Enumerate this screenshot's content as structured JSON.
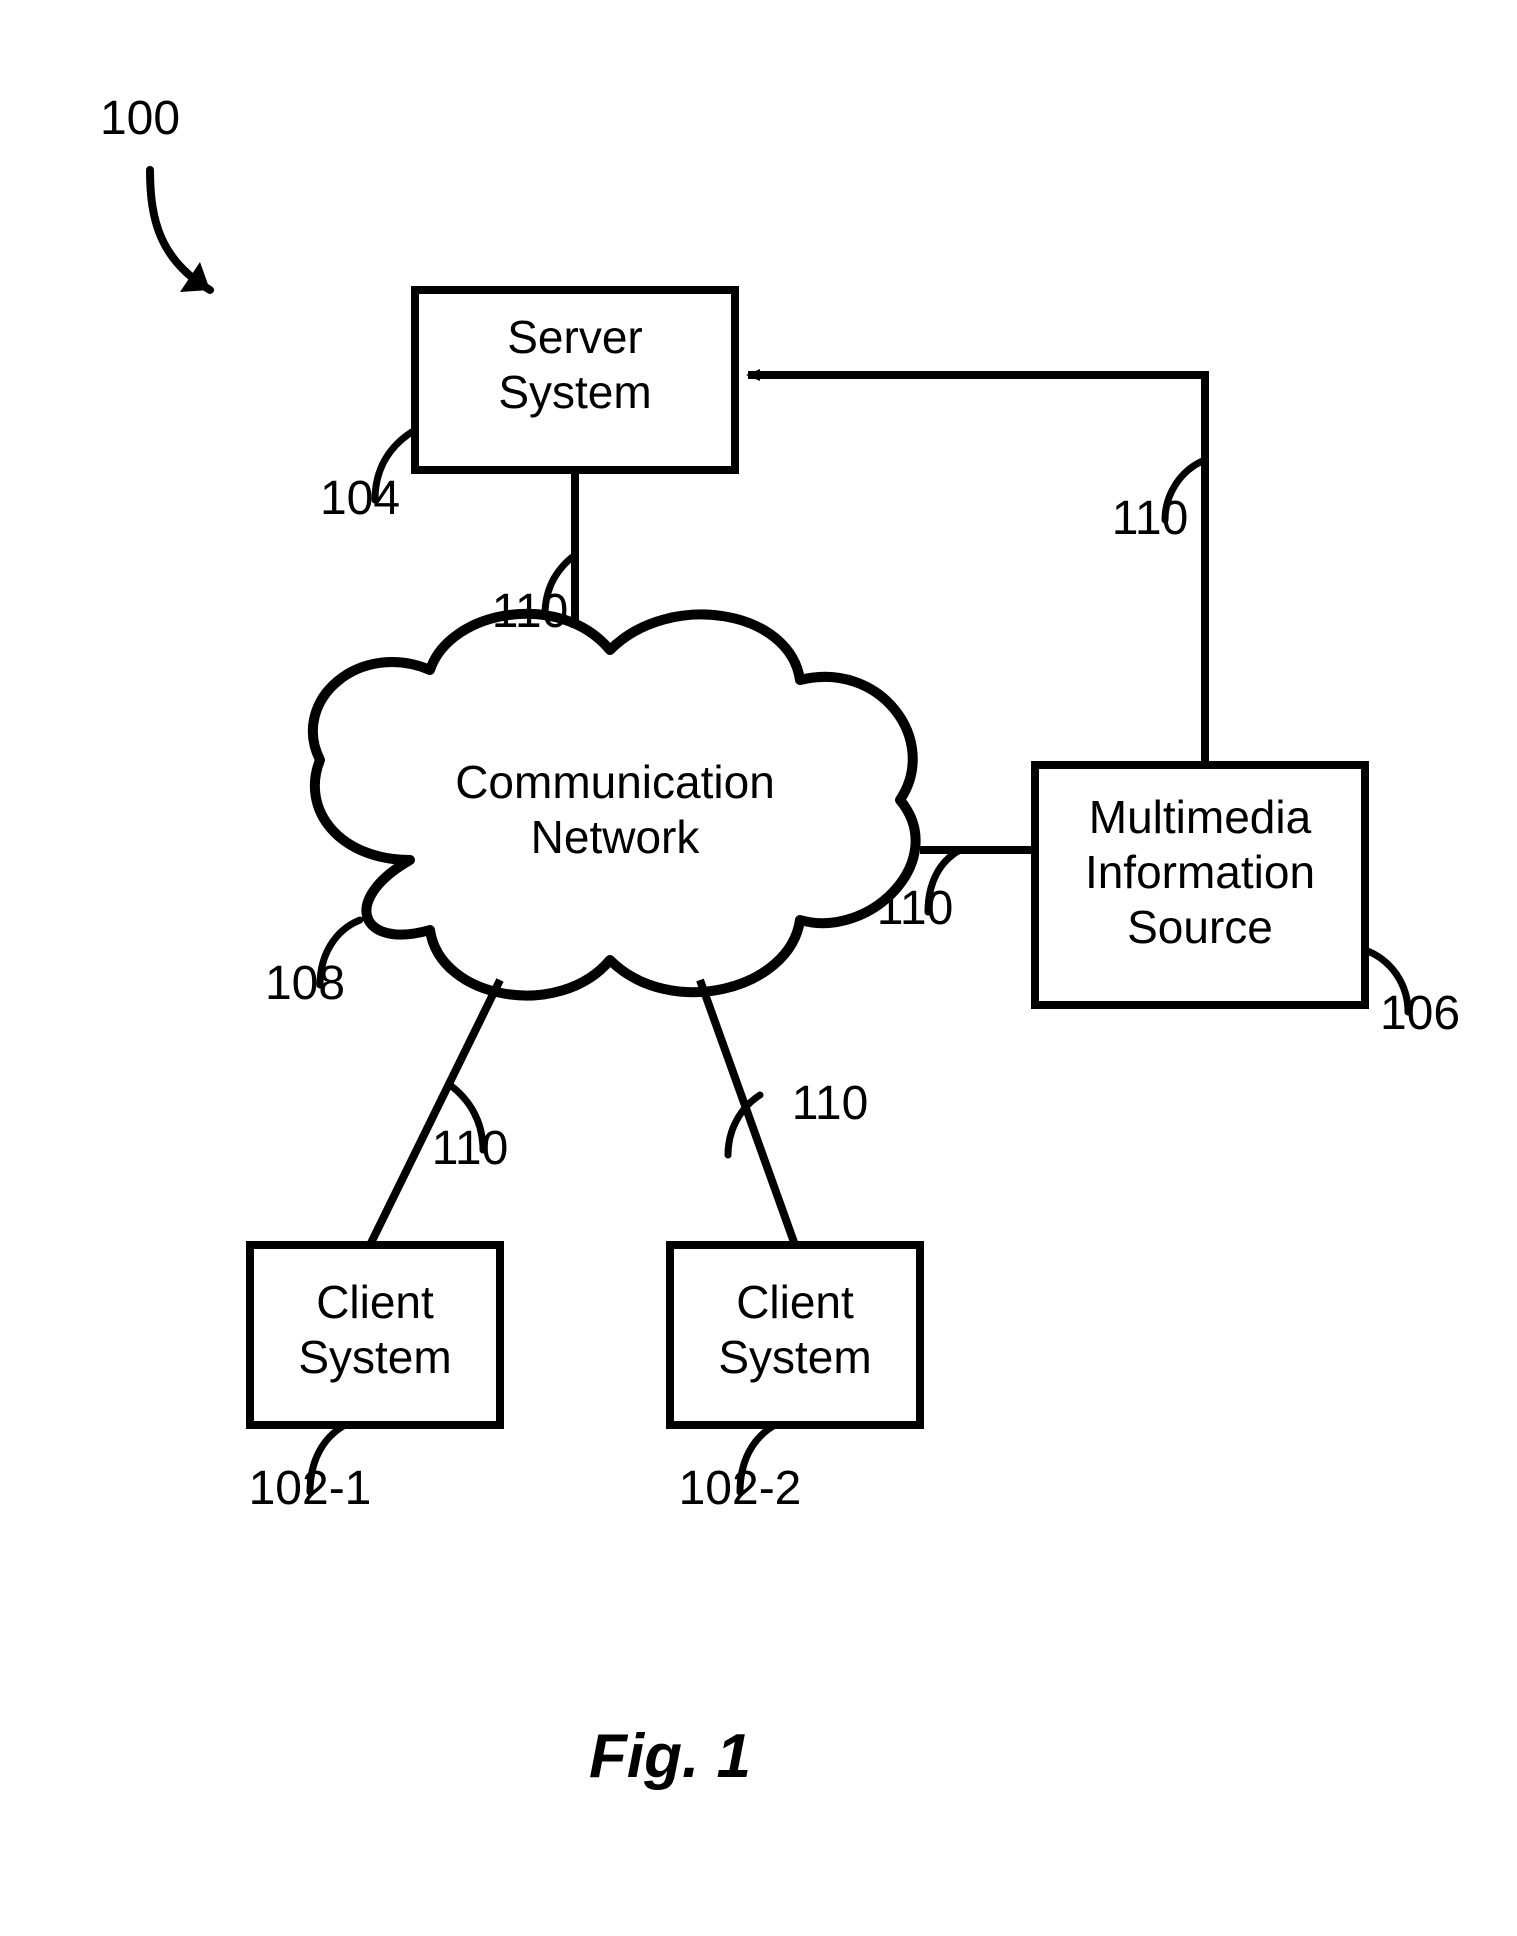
{
  "figure": {
    "number_label": "100",
    "caption": "Fig. 1"
  },
  "nodes": {
    "server": {
      "label_line1": "Server",
      "label_line2": "System",
      "ref": "104"
    },
    "network": {
      "label_line1": "Communication",
      "label_line2": "Network",
      "ref": "108"
    },
    "source": {
      "label_line1": "Multimedia",
      "label_line2": "Information",
      "label_line3": "Source",
      "ref": "106"
    },
    "client1": {
      "label_line1": "Client",
      "label_line2": "System",
      "ref": "102-1"
    },
    "client2": {
      "label_line1": "Client",
      "label_line2": "System",
      "ref": "102-2"
    }
  },
  "links": {
    "server_network": {
      "ref": "110"
    },
    "source_server": {
      "ref": "110"
    },
    "network_source": {
      "ref": "110"
    },
    "network_client1": {
      "ref": "110"
    },
    "network_client2": {
      "ref": "110"
    }
  }
}
